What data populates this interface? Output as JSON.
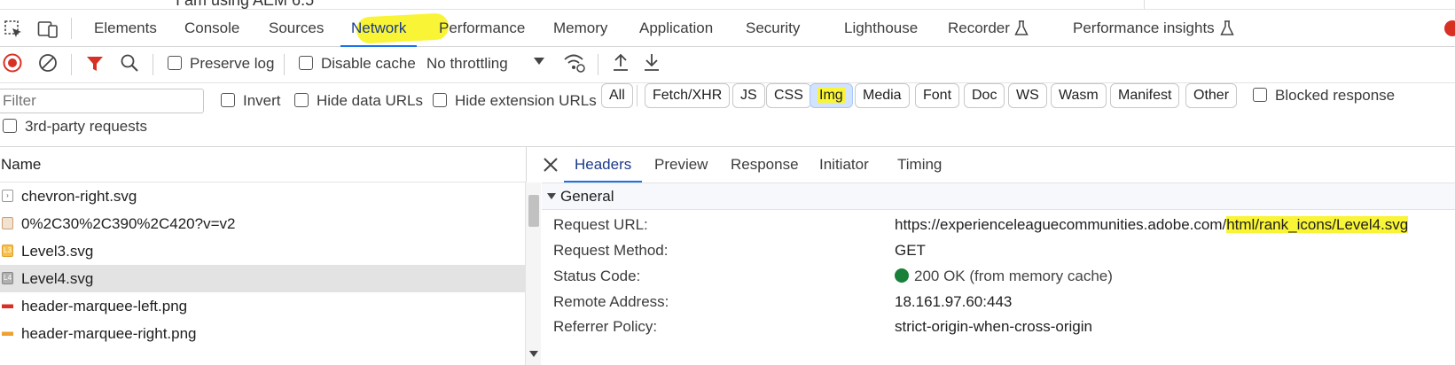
{
  "partial_top_text": "I am using AEM 6.5",
  "tabs": [
    {
      "label": "Elements"
    },
    {
      "label": "Console"
    },
    {
      "label": "Sources"
    },
    {
      "label": "Network"
    },
    {
      "label": "Performance"
    },
    {
      "label": "Memory"
    },
    {
      "label": "Application"
    },
    {
      "label": "Security"
    },
    {
      "label": "Lighthouse"
    },
    {
      "label": "Recorder"
    },
    {
      "label": "Performance insights"
    }
  ],
  "toolbar": {
    "preserve_log": "Preserve log",
    "disable_cache": "Disable cache",
    "throttling": "No throttling"
  },
  "filter": {
    "placeholder": "Filter",
    "invert": "Invert",
    "hide_data_urls": "Hide data URLs",
    "hide_extension_urls": "Hide extension URLs",
    "types": [
      "All",
      "Fetch/XHR",
      "JS",
      "CSS",
      "Img",
      "Media",
      "Font",
      "Doc",
      "WS",
      "Wasm",
      "Manifest",
      "Other"
    ],
    "blocked": "Blocked response",
    "third_party": "3rd-party requests"
  },
  "requests": {
    "header": "Name",
    "rows": [
      {
        "name": "chevron-right.svg"
      },
      {
        "name": "0%2C30%2C390%2C420?v=v2"
      },
      {
        "name": "Level3.svg"
      },
      {
        "name": "Level4.svg"
      },
      {
        "name": "header-marquee-left.png"
      },
      {
        "name": "header-marquee-right.png"
      }
    ]
  },
  "details": {
    "tabs": [
      "Headers",
      "Preview",
      "Response",
      "Initiator",
      "Timing"
    ],
    "section": "General",
    "fields": {
      "url_label": "Request URL:",
      "url_prefix": "https://experienceleaguecommunities.adobe.com/",
      "url_highlight": "html/rank_icons/Level4.svg",
      "method_label": "Request Method:",
      "method": "GET",
      "status_label": "Status Code:",
      "status": "200 OK (from memory cache)",
      "remote_label": "Remote Address:",
      "remote": "18.161.97.60:443",
      "referrer_label": "Referrer Policy:",
      "referrer": "strict-origin-when-cross-origin"
    }
  },
  "colors": {
    "accent": "#1a73e8",
    "highlight": "#f9f536",
    "status_ok": "#188038",
    "record": "#d93025",
    "filter_icon": "#d93025"
  }
}
